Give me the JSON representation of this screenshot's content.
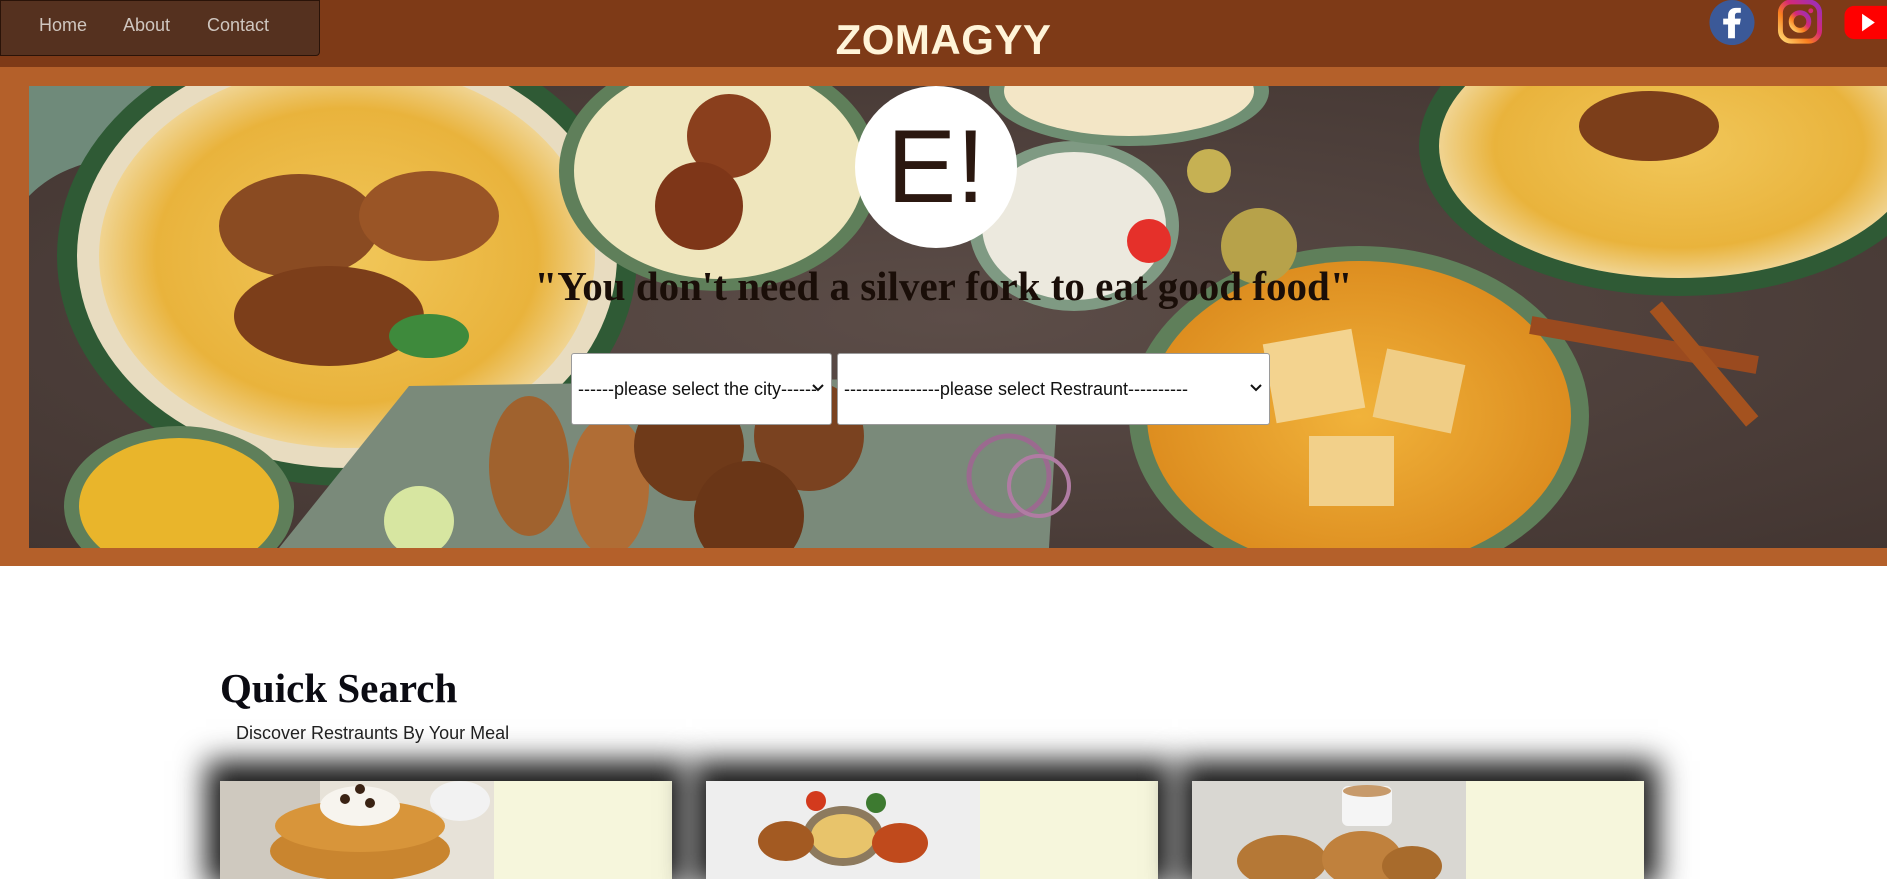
{
  "nav": {
    "home": "Home",
    "about": "About",
    "contact": "Contact"
  },
  "brand": "ZOMAGYY",
  "social": {
    "facebook_icon": "facebook-icon",
    "instagram_icon": "instagram-icon",
    "youtube_icon": "youtube-icon"
  },
  "hero": {
    "logo_text": "E!",
    "tagline": "\"You don't need a silver fork to eat good food\"",
    "city_select": "------please select the city------",
    "restaurant_select": "----------------please select Restraunt----------"
  },
  "quick_search": {
    "title": "Quick Search",
    "subtitle": "Discover Restraunts By Your Meal"
  },
  "colors": {
    "topbar": "#7e3a17",
    "navbox": "#55311f",
    "hero_frame": "#b4602a",
    "card_bg": "#f6f6dc"
  }
}
